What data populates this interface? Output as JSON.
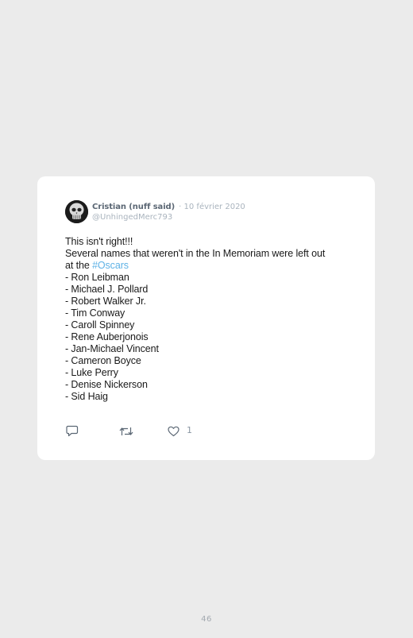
{
  "tweet": {
    "author_name": "Cristian (nuff said)",
    "date": "· 10 février 2020",
    "handle": "@UnhingedMerc793",
    "lines": [
      "This isn't right!!!",
      "Several names that weren't in the In Memoriam were left out"
    ],
    "hashtag_prefix": "at the ",
    "hashtag": "#Oscars",
    "names": [
      "- Ron Leibman",
      "- Michael J. Pollard",
      "- Robert Walker Jr.",
      "- Tim Conway",
      "- Caroll Spinney",
      "- Rene Auberjonois",
      "- Jan-Michael Vincent",
      "- Cameron Boyce",
      "- Luke Perry",
      "- Denise Nickerson",
      "- Sid Haig"
    ],
    "like_count": "1"
  },
  "icons": {
    "avatar": "skull-avatar",
    "reply": "reply-icon",
    "retweet": "retweet-icon",
    "like": "heart-icon"
  },
  "colors": {
    "background": "#ebebeb",
    "card": "#ffffff",
    "hashtag": "#5eb2e6",
    "name": "#5b6774",
    "muted": "#aab4be"
  },
  "page_number": "46"
}
